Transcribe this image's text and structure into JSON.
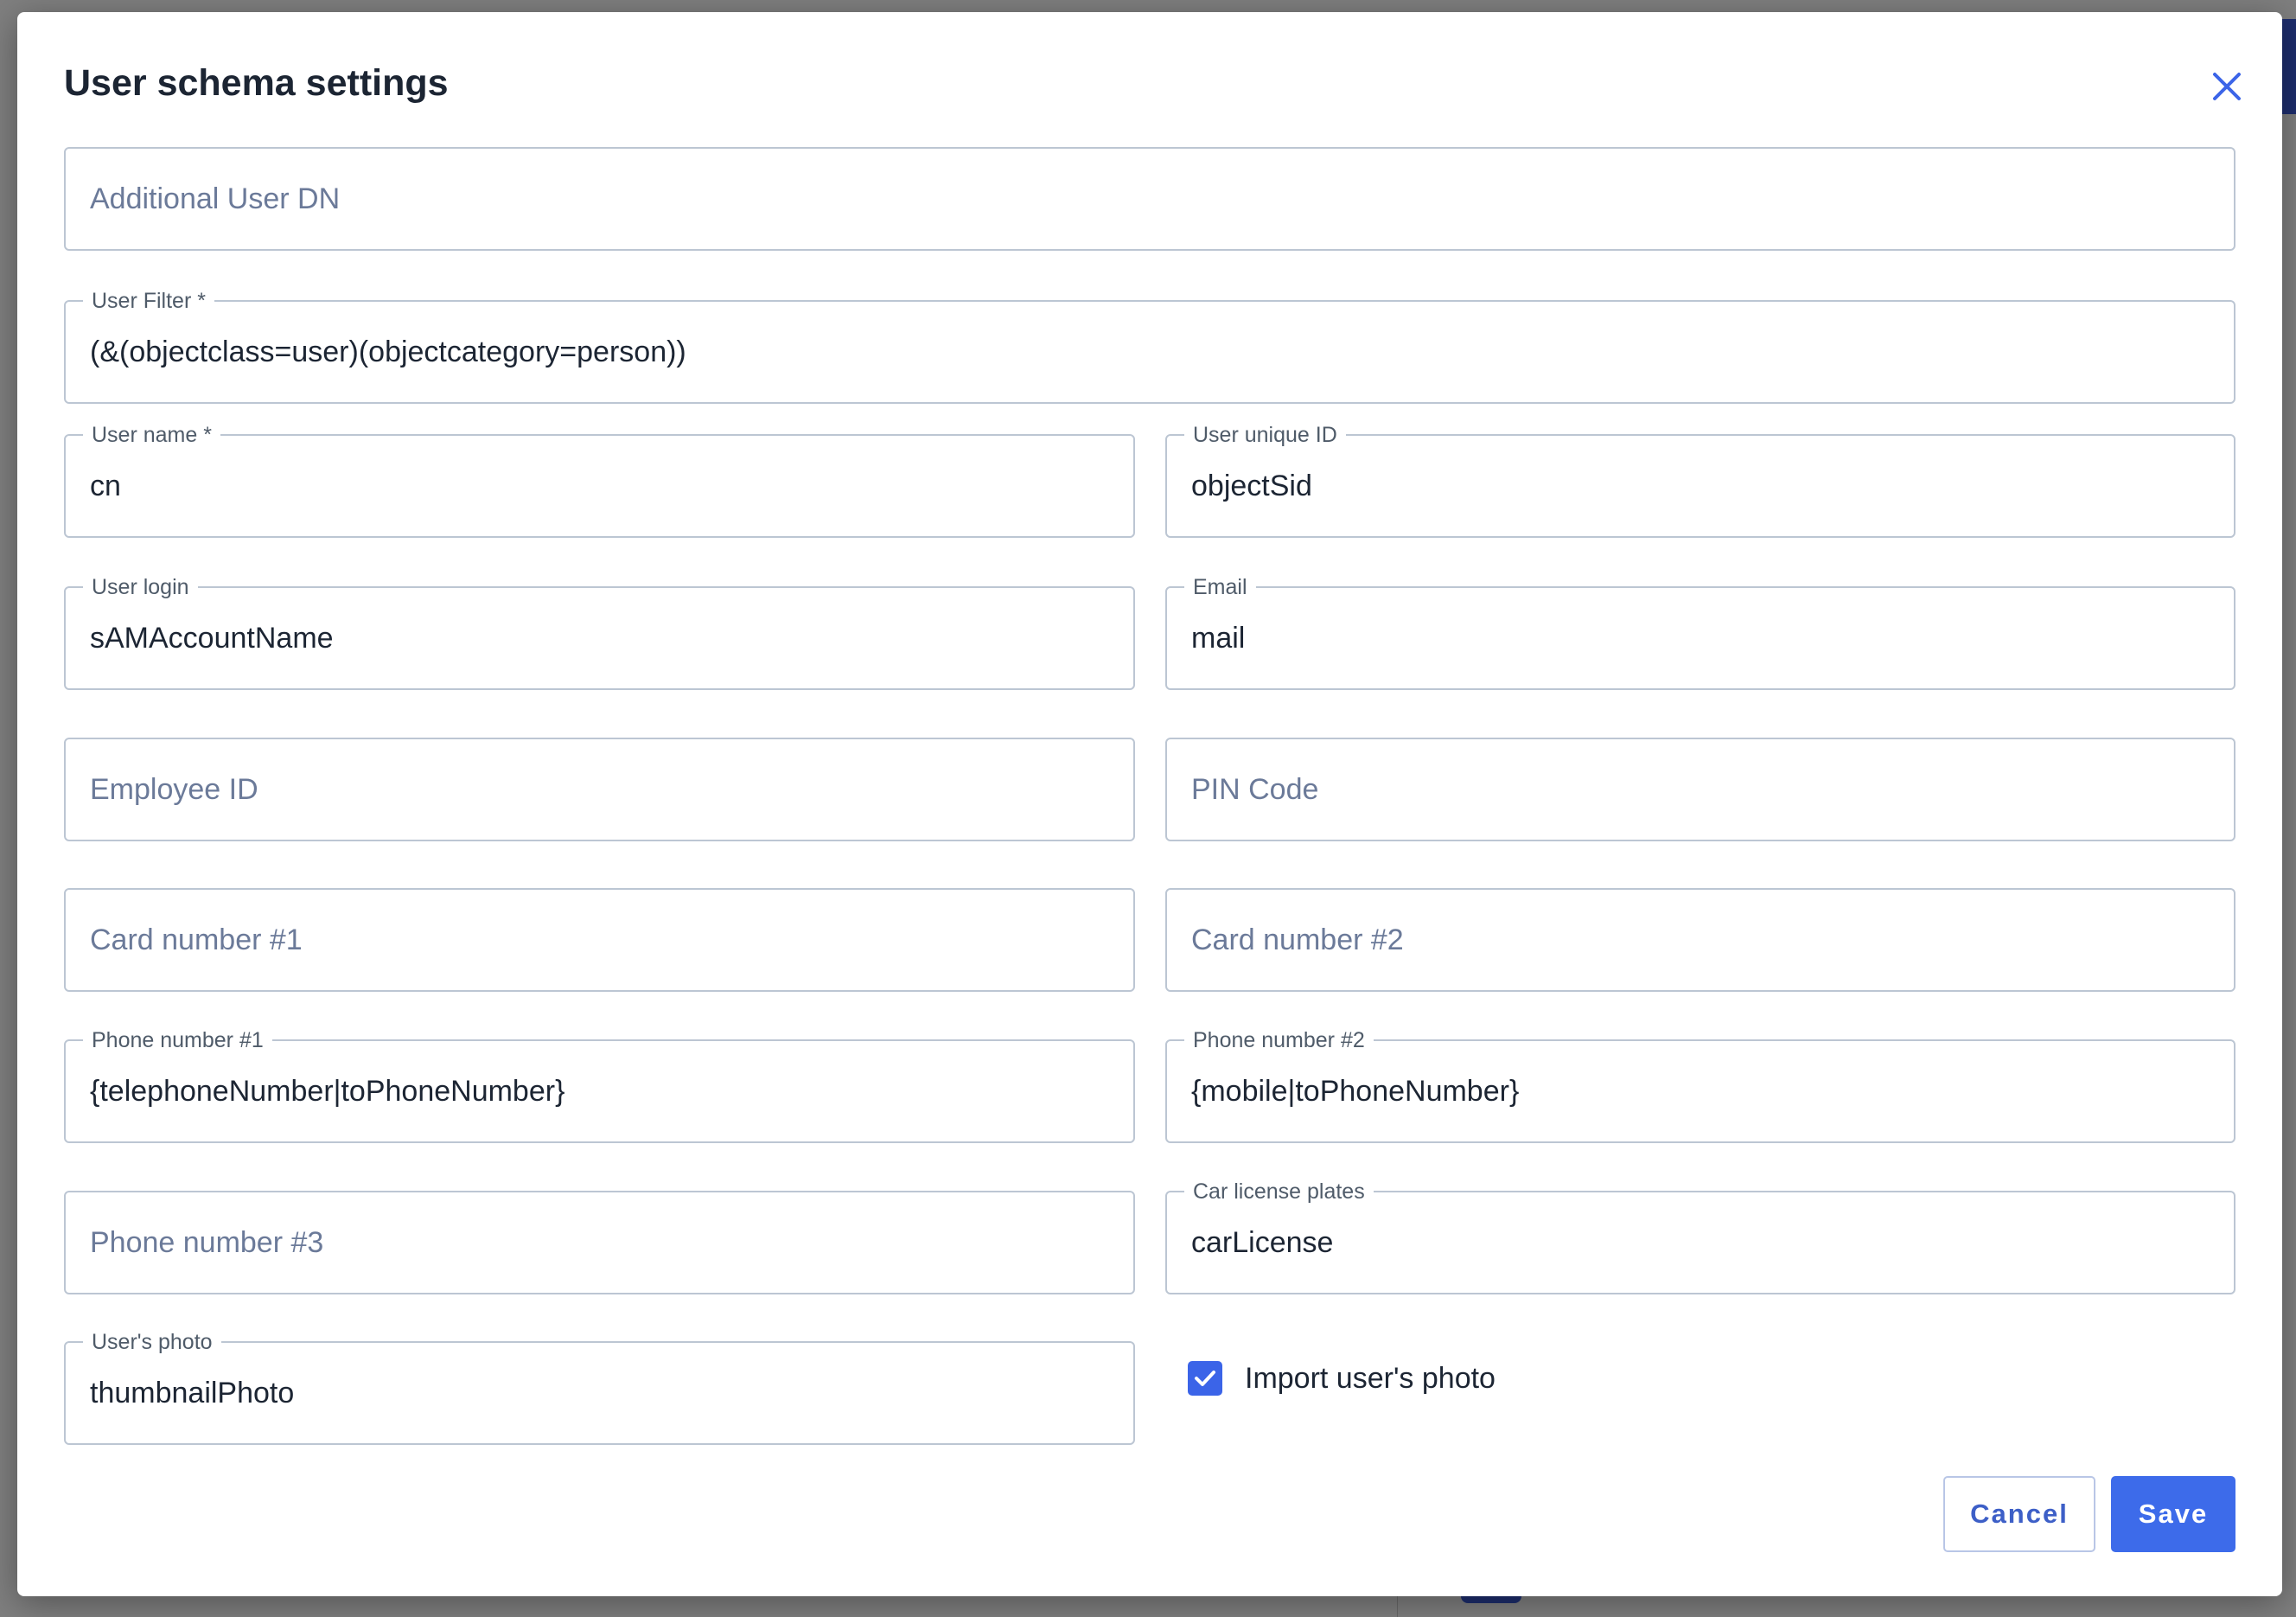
{
  "dialog": {
    "title": "User schema settings"
  },
  "fields": {
    "additional_user_dn": {
      "label": "",
      "placeholder": "Additional User DN",
      "value": ""
    },
    "user_filter": {
      "label": "User Filter *",
      "value": "(&(objectclass=user)(objectcategory=person))"
    },
    "user_name": {
      "label": "User name *",
      "value": "cn"
    },
    "user_unique_id": {
      "label": "User unique ID",
      "value": "objectSid"
    },
    "user_login": {
      "label": "User login",
      "value": "sAMAccountName"
    },
    "email": {
      "label": "Email",
      "value": "mail"
    },
    "employee_id": {
      "placeholder": "Employee ID",
      "value": ""
    },
    "pin_code": {
      "placeholder": "PIN Code",
      "value": ""
    },
    "card_number_1": {
      "placeholder": "Card number #1",
      "value": ""
    },
    "card_number_2": {
      "placeholder": "Card number #2",
      "value": ""
    },
    "phone_number_1": {
      "label": "Phone number #1",
      "value": "{telephoneNumber|toPhoneNumber}"
    },
    "phone_number_2": {
      "label": "Phone number #2",
      "value": "{mobile|toPhoneNumber}"
    },
    "phone_number_3": {
      "placeholder": "Phone number #3",
      "value": ""
    },
    "car_license_plates": {
      "label": "Car license plates",
      "value": "carLicense"
    },
    "users_photo": {
      "label": "User's photo",
      "value": "thumbnailPhoto"
    }
  },
  "import_photo": {
    "label": "Import user's photo",
    "checked": true
  },
  "actions": {
    "cancel_label": "Cancel",
    "save_label": "Save"
  },
  "colors": {
    "accent": "#3d6bea",
    "title_text": "#1c2533",
    "placeholder_text": "#6b7a99",
    "field_border": "#bcc6d3"
  }
}
